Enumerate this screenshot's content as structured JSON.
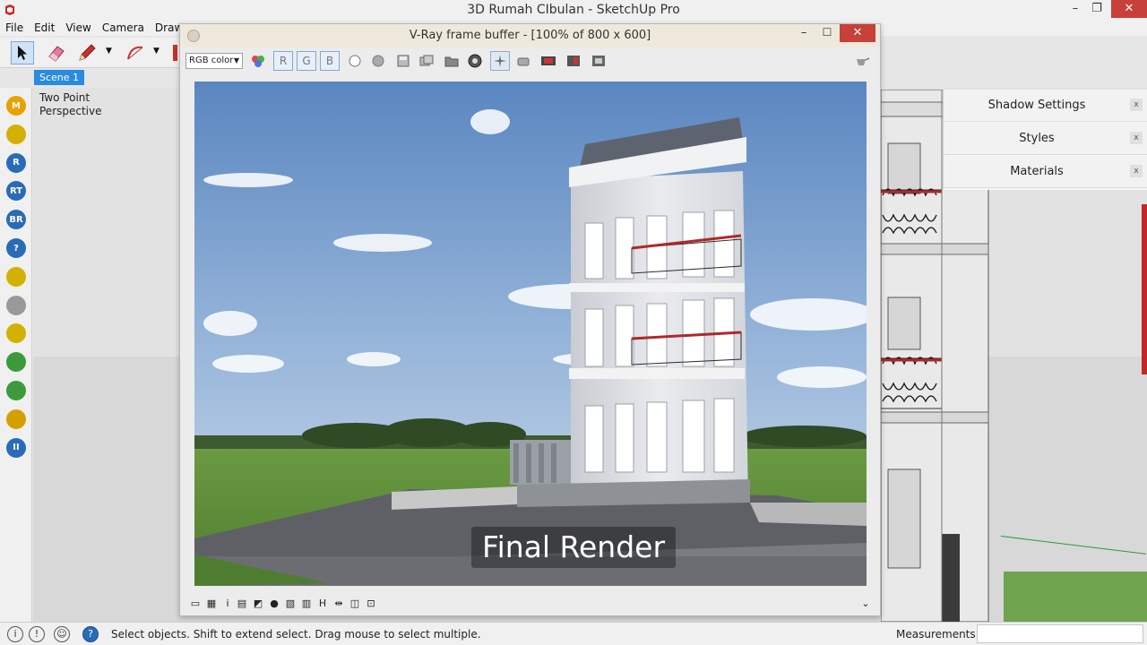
{
  "app": {
    "title": "3D Rumah CIbulan - SketchUp Pro"
  },
  "menu": [
    "File",
    "Edit",
    "View",
    "Camera",
    "Draw"
  ],
  "scene": {
    "tab": "Scene 1",
    "label_line1": "Two Point",
    "label_line2": "Perspective"
  },
  "left_tools": [
    {
      "icon": "m-icon",
      "text": "M",
      "color": "#e8a200"
    },
    {
      "icon": "tag-icon",
      "text": "",
      "color": "#d4b000"
    },
    {
      "icon": "r-icon",
      "text": "R",
      "color": "#2a6bb5"
    },
    {
      "icon": "rt-icon",
      "text": "RT",
      "color": "#2a6bb5"
    },
    {
      "icon": "br-icon",
      "text": "BR",
      "color": "#2a6bb5"
    },
    {
      "icon": "help-icon",
      "text": "?",
      "color": "#2a6bb5"
    },
    {
      "icon": "tag2-icon",
      "text": "",
      "color": "#d4b000"
    },
    {
      "icon": "sphere-icon",
      "text": "",
      "color": "#999999"
    },
    {
      "icon": "plane-icon",
      "text": "",
      "color": "#d4b000"
    },
    {
      "icon": "tree-icon",
      "text": "",
      "color": "#3c9a3c"
    },
    {
      "icon": "tree2-icon",
      "text": "",
      "color": "#3c9a3c"
    },
    {
      "icon": "target-icon",
      "text": "",
      "color": "#d4a000"
    },
    {
      "icon": "pause-icon",
      "text": "II",
      "color": "#2a6bb5"
    }
  ],
  "tray": {
    "items": [
      "Shadow Settings",
      "Styles",
      "Materials"
    ],
    "close": "x"
  },
  "vfb": {
    "title": "V-Ray frame buffer - [100% of 800 x 600]",
    "channel": "RGB color",
    "r": "R",
    "g": "G",
    "b": "B",
    "caption": "Final Render"
  },
  "status": {
    "text": "Select objects. Shift to extend select. Drag mouse to select multiple.",
    "measurements_label": "Measurements"
  }
}
